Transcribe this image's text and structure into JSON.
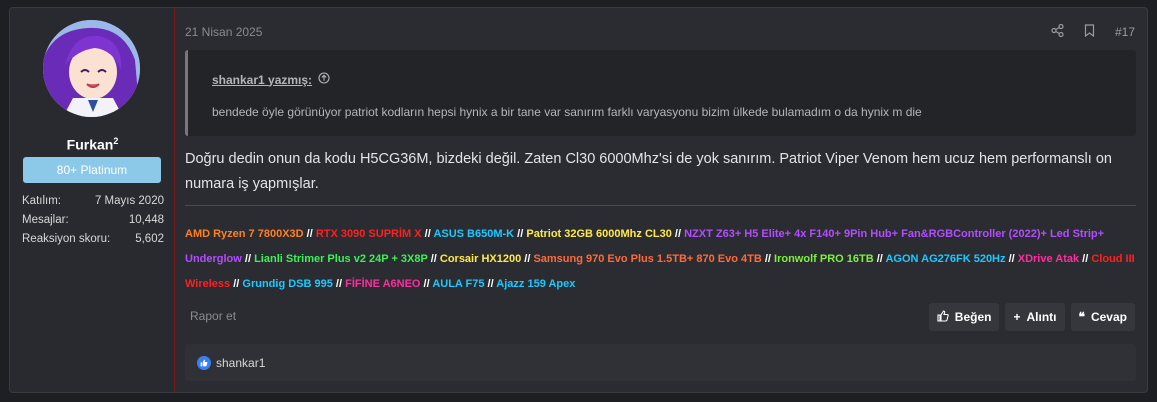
{
  "post": {
    "date": "21 Nisan 2025",
    "post_number": "#17",
    "author": {
      "name": "Furkan",
      "sup": "2",
      "badge": "80+ Platinum",
      "stats": [
        {
          "label": "Katılım:",
          "value": "7 Mayıs 2020"
        },
        {
          "label": "Mesajlar:",
          "value": "10,448"
        },
        {
          "label": "Reaksiyon skoru:",
          "value": "5,602"
        }
      ]
    },
    "quote": {
      "author": "shankar1 yazmış:",
      "text": "bendede öyle görünüyor patriot kodların hepsi hynix a bir tane var sanırım farklı varyasyonu bizim ülkede bulamadım o da hynix m die"
    },
    "message": "Doğru dedin onun da kodu H5CG36M, bizdeki değil. Zaten Cl30 6000Mhz'si de yok sanırım. Patriot Viper Venom hem ucuz hem performanslı on numara iş yapmışlar.",
    "signature": [
      {
        "text": "AMD Ryzen 7 7800X3D",
        "color": "#ff7f27"
      },
      {
        "text": "RTX 3090 SUPRİM X",
        "color": "#ff2020"
      },
      {
        "text": "ASUS B650M-K",
        "color": "#1ec8ff"
      },
      {
        "text": "Patriot 32GB 6000Mhz CL30",
        "color": "#ffe94a"
      },
      {
        "text": "NZXT Z63+ H5 Elite+ 4x F140+ 9Pin Hub+ Fan&RGBController (2022)+ Led Strip+ Underglow",
        "color": "#b34dff"
      },
      {
        "text": "Lianli Strimer Plus v2 24P + 3X8P",
        "color": "#3cf05a"
      },
      {
        "text": "Corsair HX1200",
        "color": "#ffe94a"
      },
      {
        "text": "Samsung 970 Evo Plus 1.5TB+ 870 Evo 4TB",
        "color": "#ff6a3d"
      },
      {
        "text": "Ironwolf PRO 16TB",
        "color": "#7cf03c"
      },
      {
        "text": "AGON AG276FK 520Hz",
        "color": "#1ec8ff"
      },
      {
        "text": "XDrive Atak",
        "color": "#ff2da0"
      },
      {
        "text": "Cloud III Wireless",
        "color": "#ff2020"
      },
      {
        "text": "Grundig DSB 995",
        "color": "#1ec8ff"
      },
      {
        "text": "FİFİNE A6NEO",
        "color": "#ff2da0"
      },
      {
        "text": "AULA F75",
        "color": "#1ec8ff"
      },
      {
        "text": "Ajazz 159 Apex",
        "color": "#1ec8ff"
      }
    ],
    "signature_separator": "//",
    "report_label": "Rapor et",
    "actions": {
      "like": "Beğen",
      "quote": "Alıntı",
      "reply": "Cevap"
    },
    "reactions": {
      "user": "shankar1"
    }
  }
}
